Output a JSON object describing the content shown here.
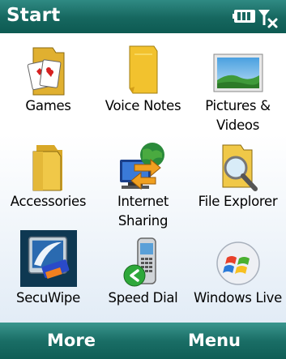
{
  "titlebar": {
    "title": "Start",
    "battery_icon": "battery-full-icon",
    "signal_icon": "no-signal-icon"
  },
  "apps": [
    {
      "label": "Games",
      "icon": "games-folder-icon"
    },
    {
      "label": "Voice Notes",
      "icon": "voice-notes-icon"
    },
    {
      "label": "Pictures & Videos",
      "icon": "pictures-videos-icon"
    },
    {
      "label": "Accessories",
      "icon": "accessories-folder-icon"
    },
    {
      "label": "Internet Sharing",
      "icon": "internet-sharing-icon"
    },
    {
      "label": "File Explorer",
      "icon": "file-explorer-icon"
    },
    {
      "label": "SecuWipe",
      "icon": "secuwipe-icon",
      "selected": true
    },
    {
      "label": "Speed Dial",
      "icon": "speed-dial-icon"
    },
    {
      "label": "Windows Live",
      "icon": "windows-live-icon"
    }
  ],
  "softkeys": {
    "left": "More",
    "right": "Menu"
  },
  "colors": {
    "titlebar": "#16675f",
    "softbar": "#1a6e66",
    "selection": "#0e3852"
  }
}
